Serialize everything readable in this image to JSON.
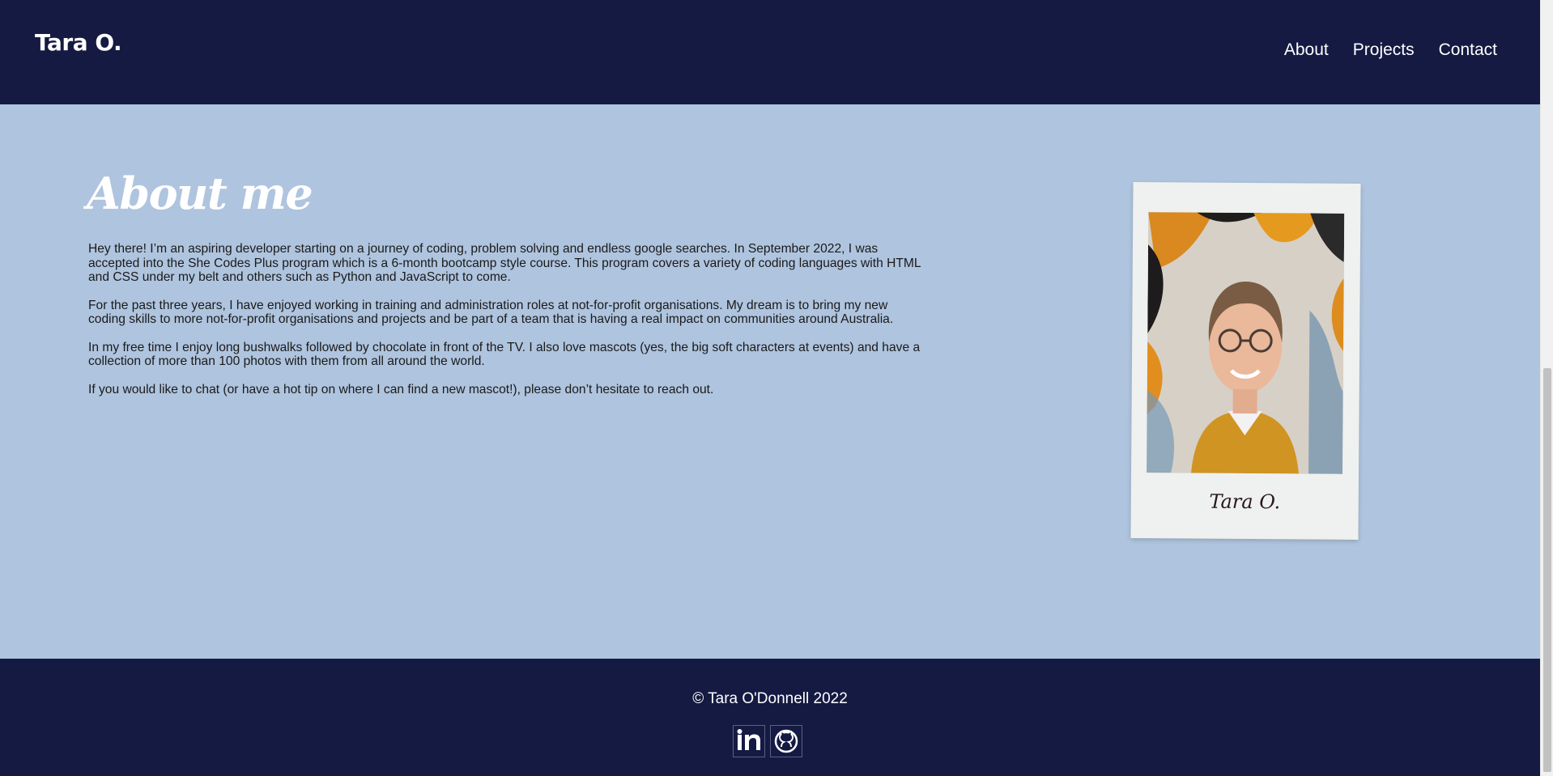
{
  "header": {
    "brand": "Tara O.",
    "nav": [
      "About",
      "Projects",
      "Contact"
    ]
  },
  "about": {
    "title": "About me",
    "paragraphs": [
      "Hey there! I’m an aspiring developer starting on a journey of coding, problem solving and endless google searches. In September 2022, I was accepted into the She Codes Plus program which is a 6-month bootcamp style course. This program covers a variety of coding languages with HTML and CSS under my belt and others such as Python and JavaScript to come.",
      "For the past three years, I have enjoyed working in training and administration roles at not-for-profit organisations. My dream is to bring my new coding skills to more not-for-profit organisations and projects and be part of a team that is having a real impact on communities around Australia.",
      "In my free time I enjoy long bushwalks followed by chocolate in front of the TV. I also love mascots (yes, the big soft characters at events) and have a collection of more than 100 photos with them from all around the world.",
      "If you would like to chat (or have a hot tip on where I can find a new mascot!), please don’t hesitate to reach out."
    ],
    "signature": "Tara O."
  },
  "footer": {
    "copyright": "© Tara O'Donnell 2022",
    "social": [
      "linkedin-icon",
      "github-icon"
    ]
  },
  "colors": {
    "header_bg": "#151a43",
    "main_bg": "#afc4de",
    "footer_bg": "#151a43",
    "text_light": "#ffffff",
    "text_dark": "#1a1a1a"
  }
}
